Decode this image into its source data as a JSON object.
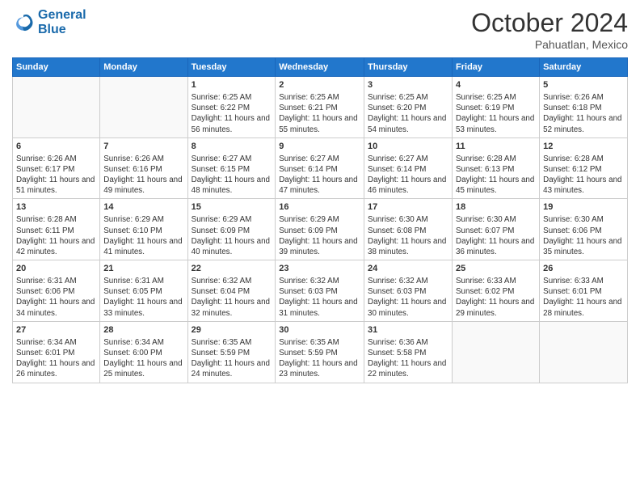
{
  "header": {
    "logo_line1": "General",
    "logo_line2": "Blue",
    "month": "October 2024",
    "location": "Pahuatlan, Mexico"
  },
  "weekdays": [
    "Sunday",
    "Monday",
    "Tuesday",
    "Wednesday",
    "Thursday",
    "Friday",
    "Saturday"
  ],
  "weeks": [
    [
      {
        "day": "",
        "info": ""
      },
      {
        "day": "",
        "info": ""
      },
      {
        "day": "1",
        "info": "Sunrise: 6:25 AM\nSunset: 6:22 PM\nDaylight: 11 hours and 56 minutes."
      },
      {
        "day": "2",
        "info": "Sunrise: 6:25 AM\nSunset: 6:21 PM\nDaylight: 11 hours and 55 minutes."
      },
      {
        "day": "3",
        "info": "Sunrise: 6:25 AM\nSunset: 6:20 PM\nDaylight: 11 hours and 54 minutes."
      },
      {
        "day": "4",
        "info": "Sunrise: 6:25 AM\nSunset: 6:19 PM\nDaylight: 11 hours and 53 minutes."
      },
      {
        "day": "5",
        "info": "Sunrise: 6:26 AM\nSunset: 6:18 PM\nDaylight: 11 hours and 52 minutes."
      }
    ],
    [
      {
        "day": "6",
        "info": "Sunrise: 6:26 AM\nSunset: 6:17 PM\nDaylight: 11 hours and 51 minutes."
      },
      {
        "day": "7",
        "info": "Sunrise: 6:26 AM\nSunset: 6:16 PM\nDaylight: 11 hours and 49 minutes."
      },
      {
        "day": "8",
        "info": "Sunrise: 6:27 AM\nSunset: 6:15 PM\nDaylight: 11 hours and 48 minutes."
      },
      {
        "day": "9",
        "info": "Sunrise: 6:27 AM\nSunset: 6:14 PM\nDaylight: 11 hours and 47 minutes."
      },
      {
        "day": "10",
        "info": "Sunrise: 6:27 AM\nSunset: 6:14 PM\nDaylight: 11 hours and 46 minutes."
      },
      {
        "day": "11",
        "info": "Sunrise: 6:28 AM\nSunset: 6:13 PM\nDaylight: 11 hours and 45 minutes."
      },
      {
        "day": "12",
        "info": "Sunrise: 6:28 AM\nSunset: 6:12 PM\nDaylight: 11 hours and 43 minutes."
      }
    ],
    [
      {
        "day": "13",
        "info": "Sunrise: 6:28 AM\nSunset: 6:11 PM\nDaylight: 11 hours and 42 minutes."
      },
      {
        "day": "14",
        "info": "Sunrise: 6:29 AM\nSunset: 6:10 PM\nDaylight: 11 hours and 41 minutes."
      },
      {
        "day": "15",
        "info": "Sunrise: 6:29 AM\nSunset: 6:09 PM\nDaylight: 11 hours and 40 minutes."
      },
      {
        "day": "16",
        "info": "Sunrise: 6:29 AM\nSunset: 6:09 PM\nDaylight: 11 hours and 39 minutes."
      },
      {
        "day": "17",
        "info": "Sunrise: 6:30 AM\nSunset: 6:08 PM\nDaylight: 11 hours and 38 minutes."
      },
      {
        "day": "18",
        "info": "Sunrise: 6:30 AM\nSunset: 6:07 PM\nDaylight: 11 hours and 36 minutes."
      },
      {
        "day": "19",
        "info": "Sunrise: 6:30 AM\nSunset: 6:06 PM\nDaylight: 11 hours and 35 minutes."
      }
    ],
    [
      {
        "day": "20",
        "info": "Sunrise: 6:31 AM\nSunset: 6:06 PM\nDaylight: 11 hours and 34 minutes."
      },
      {
        "day": "21",
        "info": "Sunrise: 6:31 AM\nSunset: 6:05 PM\nDaylight: 11 hours and 33 minutes."
      },
      {
        "day": "22",
        "info": "Sunrise: 6:32 AM\nSunset: 6:04 PM\nDaylight: 11 hours and 32 minutes."
      },
      {
        "day": "23",
        "info": "Sunrise: 6:32 AM\nSunset: 6:03 PM\nDaylight: 11 hours and 31 minutes."
      },
      {
        "day": "24",
        "info": "Sunrise: 6:32 AM\nSunset: 6:03 PM\nDaylight: 11 hours and 30 minutes."
      },
      {
        "day": "25",
        "info": "Sunrise: 6:33 AM\nSunset: 6:02 PM\nDaylight: 11 hours and 29 minutes."
      },
      {
        "day": "26",
        "info": "Sunrise: 6:33 AM\nSunset: 6:01 PM\nDaylight: 11 hours and 28 minutes."
      }
    ],
    [
      {
        "day": "27",
        "info": "Sunrise: 6:34 AM\nSunset: 6:01 PM\nDaylight: 11 hours and 26 minutes."
      },
      {
        "day": "28",
        "info": "Sunrise: 6:34 AM\nSunset: 6:00 PM\nDaylight: 11 hours and 25 minutes."
      },
      {
        "day": "29",
        "info": "Sunrise: 6:35 AM\nSunset: 5:59 PM\nDaylight: 11 hours and 24 minutes."
      },
      {
        "day": "30",
        "info": "Sunrise: 6:35 AM\nSunset: 5:59 PM\nDaylight: 11 hours and 23 minutes."
      },
      {
        "day": "31",
        "info": "Sunrise: 6:36 AM\nSunset: 5:58 PM\nDaylight: 11 hours and 22 minutes."
      },
      {
        "day": "",
        "info": ""
      },
      {
        "day": "",
        "info": ""
      }
    ]
  ]
}
